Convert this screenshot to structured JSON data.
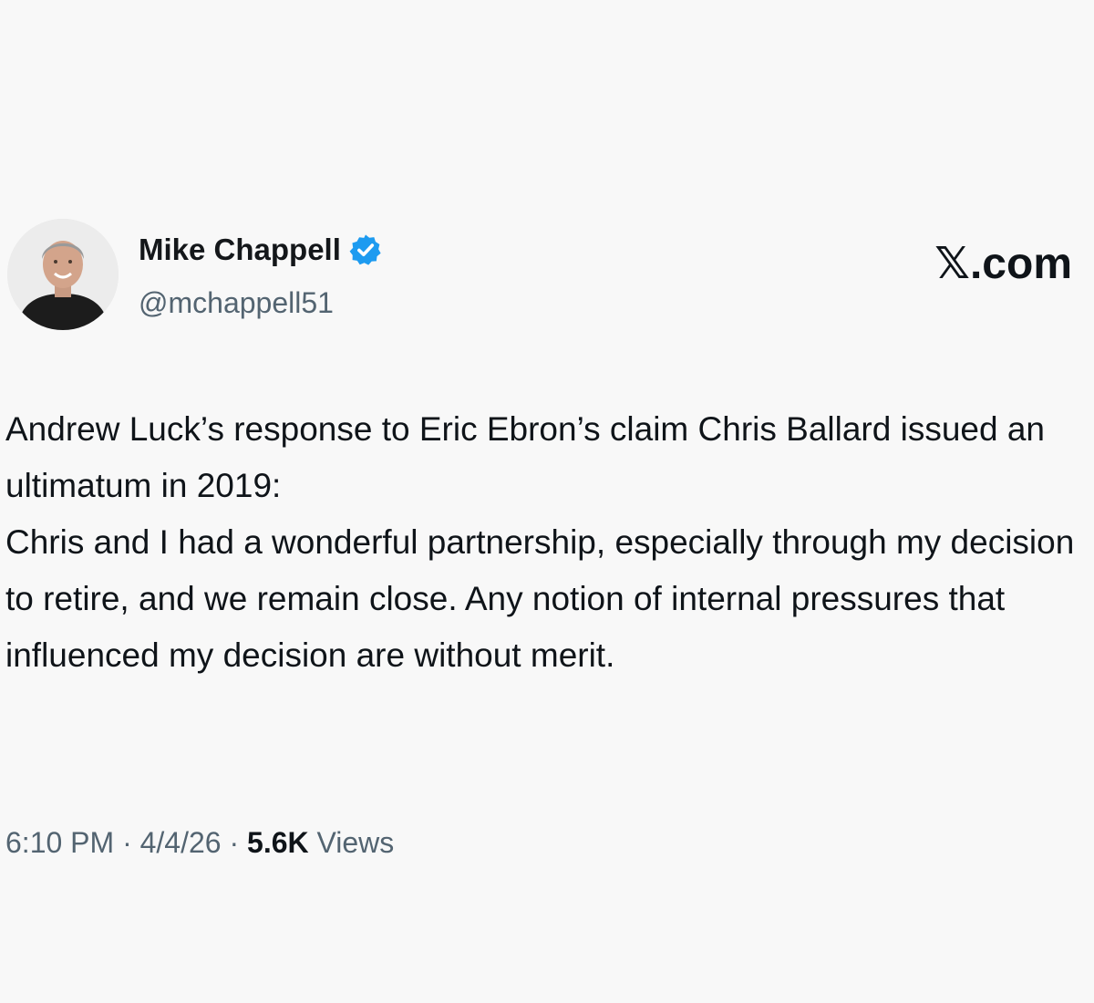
{
  "author": {
    "display_name": "Mike Chappell",
    "handle": "@mchappell51",
    "avatar_icon": "person-avatar-photo",
    "verified_icon": "verified-badge-icon",
    "verified_color": "#1d9bf0"
  },
  "brand": {
    "label": "𝕏.com"
  },
  "post": {
    "lines": [
      "Andrew Luck’s response to Eric Ebron’s claim Chris Ballard issued an ultimatum in 2019:",
      "Chris and I had a wonderful partnership, especially through my decision to retire, and we remain close. Any notion of internal pressures that influenced my decision are without merit."
    ]
  },
  "meta": {
    "time": "6:10 PM",
    "separator": "·",
    "date": "4/4/26",
    "views_count": "5.6K",
    "views_label": "Views"
  },
  "colors": {
    "background": "#f8f8f8",
    "text": "#0f1419",
    "muted": "#536471"
  }
}
